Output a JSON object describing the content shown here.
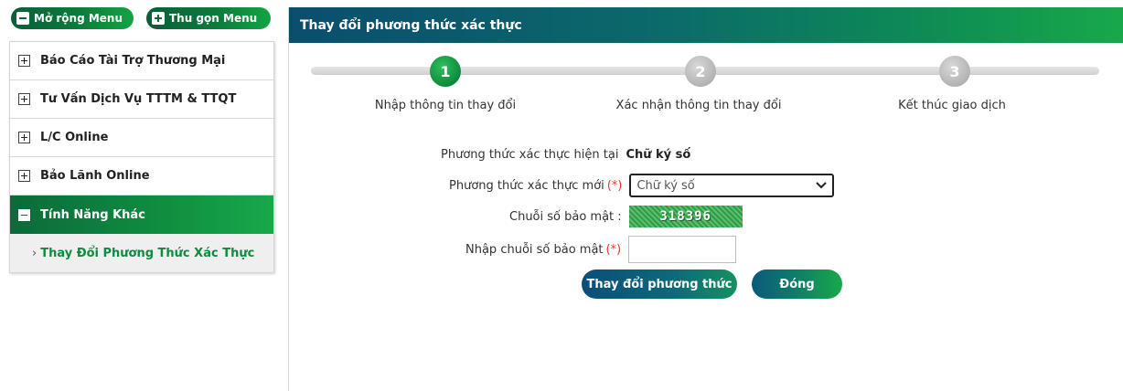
{
  "sidebar": {
    "expand_label": "Mở rộng Menu",
    "collapse_label": "Thu gọn Menu",
    "items": [
      {
        "label": "Báo Cáo Tài Trợ Thương Mại"
      },
      {
        "label": "Tư Vấn Dịch Vụ TTTM & TTQT"
      },
      {
        "label": "L/C Online"
      },
      {
        "label": "Bảo Lãnh Online"
      },
      {
        "label": "Tính Năng Khác"
      }
    ],
    "submenu_item": "Thay Đổi Phương Thức Xác Thực"
  },
  "header": {
    "title": "Thay đổi phương thức xác thực"
  },
  "steps": [
    {
      "number": "1",
      "label": "Nhập thông tin thay đổi",
      "status": "done"
    },
    {
      "number": "2",
      "label": "Xác nhận thông tin thay đổi",
      "status": "todo"
    },
    {
      "number": "3",
      "label": "Kết thúc giao dịch",
      "status": "todo"
    }
  ],
  "form": {
    "current_method_label": "Phương thức xác thực hiện tại",
    "current_method_value": "Chữ ký số",
    "new_method_label": "Phương thức xác thực mới",
    "new_method_value": "Chữ ký số",
    "required_mark": "(*)",
    "captcha_label": "Chuỗi số bảo mật :",
    "captcha_value": "318396",
    "captcha_input_label": "Nhập chuỗi số bảo mật",
    "captcha_input_value": ""
  },
  "buttons": {
    "change": "Thay đổi phương thức",
    "close": "Đóng"
  }
}
